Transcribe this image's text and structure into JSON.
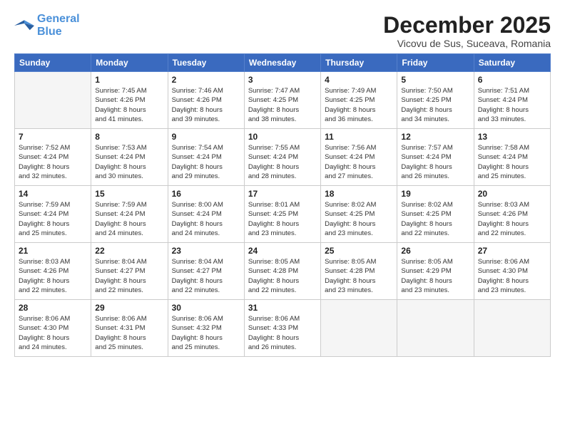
{
  "logo": {
    "line1": "General",
    "line2": "Blue"
  },
  "header": {
    "month": "December 2025",
    "location": "Vicovu de Sus, Suceava, Romania"
  },
  "weekdays": [
    "Sunday",
    "Monday",
    "Tuesday",
    "Wednesday",
    "Thursday",
    "Friday",
    "Saturday"
  ],
  "weeks": [
    [
      {
        "day": "",
        "sunrise": "",
        "sunset": "",
        "daylight": ""
      },
      {
        "day": "1",
        "sunrise": "Sunrise: 7:45 AM",
        "sunset": "Sunset: 4:26 PM",
        "daylight": "Daylight: 8 hours and 41 minutes."
      },
      {
        "day": "2",
        "sunrise": "Sunrise: 7:46 AM",
        "sunset": "Sunset: 4:26 PM",
        "daylight": "Daylight: 8 hours and 39 minutes."
      },
      {
        "day": "3",
        "sunrise": "Sunrise: 7:47 AM",
        "sunset": "Sunset: 4:25 PM",
        "daylight": "Daylight: 8 hours and 38 minutes."
      },
      {
        "day": "4",
        "sunrise": "Sunrise: 7:49 AM",
        "sunset": "Sunset: 4:25 PM",
        "daylight": "Daylight: 8 hours and 36 minutes."
      },
      {
        "day": "5",
        "sunrise": "Sunrise: 7:50 AM",
        "sunset": "Sunset: 4:25 PM",
        "daylight": "Daylight: 8 hours and 34 minutes."
      },
      {
        "day": "6",
        "sunrise": "Sunrise: 7:51 AM",
        "sunset": "Sunset: 4:24 PM",
        "daylight": "Daylight: 8 hours and 33 minutes."
      }
    ],
    [
      {
        "day": "7",
        "sunrise": "Sunrise: 7:52 AM",
        "sunset": "Sunset: 4:24 PM",
        "daylight": "Daylight: 8 hours and 32 minutes."
      },
      {
        "day": "8",
        "sunrise": "Sunrise: 7:53 AM",
        "sunset": "Sunset: 4:24 PM",
        "daylight": "Daylight: 8 hours and 30 minutes."
      },
      {
        "day": "9",
        "sunrise": "Sunrise: 7:54 AM",
        "sunset": "Sunset: 4:24 PM",
        "daylight": "Daylight: 8 hours and 29 minutes."
      },
      {
        "day": "10",
        "sunrise": "Sunrise: 7:55 AM",
        "sunset": "Sunset: 4:24 PM",
        "daylight": "Daylight: 8 hours and 28 minutes."
      },
      {
        "day": "11",
        "sunrise": "Sunrise: 7:56 AM",
        "sunset": "Sunset: 4:24 PM",
        "daylight": "Daylight: 8 hours and 27 minutes."
      },
      {
        "day": "12",
        "sunrise": "Sunrise: 7:57 AM",
        "sunset": "Sunset: 4:24 PM",
        "daylight": "Daylight: 8 hours and 26 minutes."
      },
      {
        "day": "13",
        "sunrise": "Sunrise: 7:58 AM",
        "sunset": "Sunset: 4:24 PM",
        "daylight": "Daylight: 8 hours and 25 minutes."
      }
    ],
    [
      {
        "day": "14",
        "sunrise": "Sunrise: 7:59 AM",
        "sunset": "Sunset: 4:24 PM",
        "daylight": "Daylight: 8 hours and 25 minutes."
      },
      {
        "day": "15",
        "sunrise": "Sunrise: 7:59 AM",
        "sunset": "Sunset: 4:24 PM",
        "daylight": "Daylight: 8 hours and 24 minutes."
      },
      {
        "day": "16",
        "sunrise": "Sunrise: 8:00 AM",
        "sunset": "Sunset: 4:24 PM",
        "daylight": "Daylight: 8 hours and 24 minutes."
      },
      {
        "day": "17",
        "sunrise": "Sunrise: 8:01 AM",
        "sunset": "Sunset: 4:25 PM",
        "daylight": "Daylight: 8 hours and 23 minutes."
      },
      {
        "day": "18",
        "sunrise": "Sunrise: 8:02 AM",
        "sunset": "Sunset: 4:25 PM",
        "daylight": "Daylight: 8 hours and 23 minutes."
      },
      {
        "day": "19",
        "sunrise": "Sunrise: 8:02 AM",
        "sunset": "Sunset: 4:25 PM",
        "daylight": "Daylight: 8 hours and 22 minutes."
      },
      {
        "day": "20",
        "sunrise": "Sunrise: 8:03 AM",
        "sunset": "Sunset: 4:26 PM",
        "daylight": "Daylight: 8 hours and 22 minutes."
      }
    ],
    [
      {
        "day": "21",
        "sunrise": "Sunrise: 8:03 AM",
        "sunset": "Sunset: 4:26 PM",
        "daylight": "Daylight: 8 hours and 22 minutes."
      },
      {
        "day": "22",
        "sunrise": "Sunrise: 8:04 AM",
        "sunset": "Sunset: 4:27 PM",
        "daylight": "Daylight: 8 hours and 22 minutes."
      },
      {
        "day": "23",
        "sunrise": "Sunrise: 8:04 AM",
        "sunset": "Sunset: 4:27 PM",
        "daylight": "Daylight: 8 hours and 22 minutes."
      },
      {
        "day": "24",
        "sunrise": "Sunrise: 8:05 AM",
        "sunset": "Sunset: 4:28 PM",
        "daylight": "Daylight: 8 hours and 22 minutes."
      },
      {
        "day": "25",
        "sunrise": "Sunrise: 8:05 AM",
        "sunset": "Sunset: 4:28 PM",
        "daylight": "Daylight: 8 hours and 23 minutes."
      },
      {
        "day": "26",
        "sunrise": "Sunrise: 8:05 AM",
        "sunset": "Sunset: 4:29 PM",
        "daylight": "Daylight: 8 hours and 23 minutes."
      },
      {
        "day": "27",
        "sunrise": "Sunrise: 8:06 AM",
        "sunset": "Sunset: 4:30 PM",
        "daylight": "Daylight: 8 hours and 23 minutes."
      }
    ],
    [
      {
        "day": "28",
        "sunrise": "Sunrise: 8:06 AM",
        "sunset": "Sunset: 4:30 PM",
        "daylight": "Daylight: 8 hours and 24 minutes."
      },
      {
        "day": "29",
        "sunrise": "Sunrise: 8:06 AM",
        "sunset": "Sunset: 4:31 PM",
        "daylight": "Daylight: 8 hours and 25 minutes."
      },
      {
        "day": "30",
        "sunrise": "Sunrise: 8:06 AM",
        "sunset": "Sunset: 4:32 PM",
        "daylight": "Daylight: 8 hours and 25 minutes."
      },
      {
        "day": "31",
        "sunrise": "Sunrise: 8:06 AM",
        "sunset": "Sunset: 4:33 PM",
        "daylight": "Daylight: 8 hours and 26 minutes."
      },
      {
        "day": "",
        "sunrise": "",
        "sunset": "",
        "daylight": ""
      },
      {
        "day": "",
        "sunrise": "",
        "sunset": "",
        "daylight": ""
      },
      {
        "day": "",
        "sunrise": "",
        "sunset": "",
        "daylight": ""
      }
    ]
  ]
}
